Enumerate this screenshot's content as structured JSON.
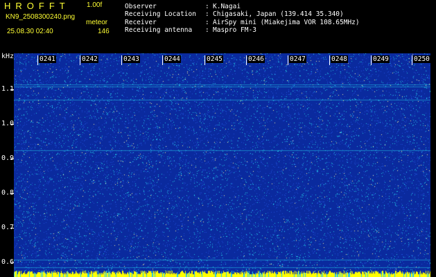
{
  "app": {
    "title": "HROFFT",
    "version": "1.00f",
    "filename": "KN9_2508300240.png",
    "mode": "meteor",
    "datetime": "25.08.30 02:40",
    "count": "146"
  },
  "meta": [
    {
      "label": "Observer",
      "value": "K.Nagai"
    },
    {
      "label": "Receiving Location",
      "value": "Chigasaki, Japan (139.414 35.340)"
    },
    {
      "label": "Receiver",
      "value": "AirSpy mini (Miakejima VOR 108.65MHz)"
    },
    {
      "label": "Receiving antenna",
      "value": "Maspro FM-3"
    }
  ],
  "waterfall": {
    "y_axis_unit": "kHz",
    "y_ticks": [
      "1.1",
      "1.0",
      "0.9",
      "0.8",
      "0.7",
      "0.6"
    ],
    "time_ticks": [
      "0241",
      "0242",
      "0243",
      "0244",
      "0245",
      "0246",
      "0247",
      "0248",
      "0249",
      "0250"
    ],
    "colors": {
      "background": "#0a2a9e",
      "noise_low": "#1e4fd8",
      "noise_mid": "#22c8e8",
      "noise_high": "#f0f0a0",
      "bottom_band": "#ffff00",
      "text": "#ffffff",
      "header_text": "#ffff33"
    }
  }
}
